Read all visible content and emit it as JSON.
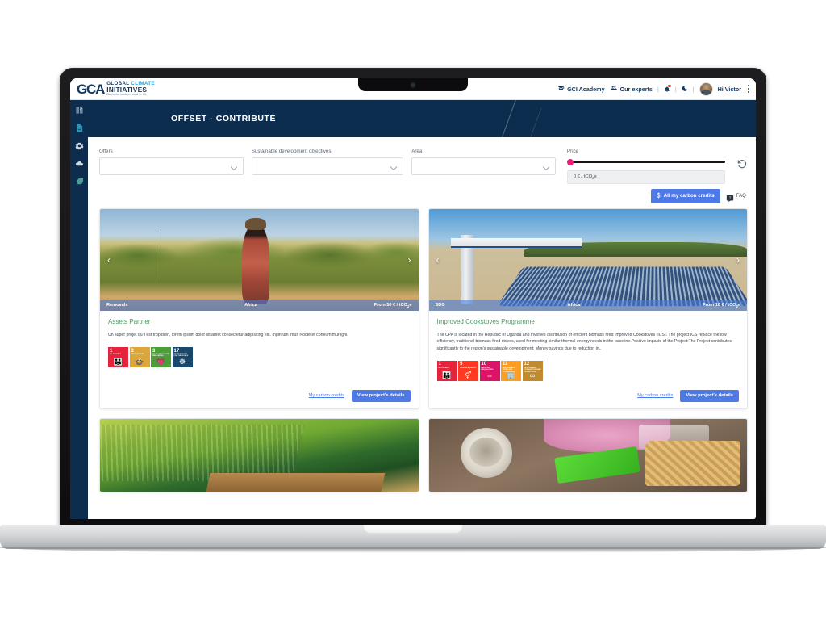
{
  "header": {
    "logo": {
      "mark": "GCA",
      "line1_a": "GLOBAL ",
      "line1_b": "CLIMATE",
      "line2": "INITIATIVES",
      "line3": "Business is connected to life"
    },
    "nav": [
      {
        "label": "GCI Academy",
        "icon": "graduation-cap-icon"
      },
      {
        "label": "Our experts",
        "icon": "people-group-icon"
      }
    ],
    "notification_icon": "bell-icon",
    "theme_icon": "moon-icon",
    "greeting": "Hi Victor",
    "menu_icon": "kebab-menu-icon"
  },
  "sidebar": {
    "items": [
      {
        "name": "reports-icon"
      },
      {
        "name": "document-icon"
      },
      {
        "name": "settings-gear-icon"
      },
      {
        "name": "cloud-icon"
      },
      {
        "name": "leaf-icon"
      }
    ]
  },
  "banner": {
    "title": "OFFSET - CONTRIBUTE"
  },
  "filters": {
    "offers": {
      "label": "Offers",
      "value": "",
      "placeholder": ""
    },
    "sdo": {
      "label": "Sustainable development objectives",
      "value": "",
      "placeholder": ""
    },
    "area": {
      "label": "Area",
      "value": "",
      "placeholder": ""
    },
    "price": {
      "label": "Price",
      "value": "0 € / tCO",
      "value_sub": "2",
      "value_suffix": "e",
      "slider_percent": 0
    },
    "reset_icon": "reset-arrow-icon"
  },
  "actions": {
    "carbon_credits_label": "All my carbon credits",
    "carbon_credits_icon": "dollar-icon",
    "faq_label": "FAQ",
    "faq_icon": "chat-bubble-icon"
  },
  "cards": [
    {
      "tag": "Removals",
      "region": "Africa",
      "price_prefix": "From 50 € / tCO",
      "price_sub": "2",
      "price_suffix": "e",
      "title": "Assets Partner",
      "description": "Un super projet qu'il est trop bien, lorem ipsum dolor sit amet consectetur adipiscing elit. Inginrum imus Nocte et coneumimur igni.",
      "sdgs": [
        {
          "num": "1",
          "name": "NO POVERTY",
          "color": "#e5243b",
          "glyph": "\u0000"
        },
        {
          "num": "2",
          "name": "ZERO HUNGER",
          "color": "#dda63a",
          "glyph": "\u0000"
        },
        {
          "num": "3",
          "name": "GOOD HEALTH AND WELL-BEING",
          "color": "#4c9f38",
          "glyph": "\u0000"
        },
        {
          "num": "17",
          "name": "PARTNERSHIPS FOR THE GOALS",
          "color": "#19486a",
          "glyph": "\u0000"
        }
      ],
      "link_label": "My carbon credits",
      "button_label": "View project's details",
      "photo": "savanna"
    },
    {
      "tag": "SDG",
      "region": "Africa",
      "price_prefix": "From 10 € / tCO",
      "price_sub": "2",
      "price_suffix": "e",
      "title": "Improved Cookstoves Programme",
      "description": "The CPA is located in the Republic of Uganda and involves distribution of efficient biomass fired Improved Cookstoves (ICS). The project ICS replace the low efficiency, traditional biomass fired stoves, used for meeting similar thermal energy needs in the baseline.Positive impacts of the Project:The Project contributes significantly to the region's sustainable development: Money savings due to reduction in..",
      "sdgs": [
        {
          "num": "1",
          "name": "NO POVERTY",
          "color": "#e5243b",
          "glyph": "\u0000"
        },
        {
          "num": "5",
          "name": "GENDER EQUALITY",
          "color": "#ff3a21",
          "glyph": "\u0000"
        },
        {
          "num": "10",
          "name": "REDUCED INEQUALITIES",
          "color": "#dd1367",
          "glyph": "\u0000"
        },
        {
          "num": "11",
          "name": "SUSTAINABLE CITIES AND COMMUNITIES",
          "color": "#fd9d24",
          "glyph": "\u0000"
        },
        {
          "num": "12",
          "name": "RESPONSIBLE CONSUMPTION AND PRODUCTION",
          "color": "#bf8b2e",
          "glyph": "∞"
        }
      ],
      "link_label": "My carbon credits",
      "button_label": "View project's details",
      "photo": "solar"
    },
    {
      "photo": "farm"
    },
    {
      "photo": "waste"
    }
  ],
  "colors": {
    "brand_navy": "#0d2d4e",
    "accent_blue": "#4e7ae8",
    "accent_pink": "#ec1e79",
    "title_green": "#4f9663"
  }
}
